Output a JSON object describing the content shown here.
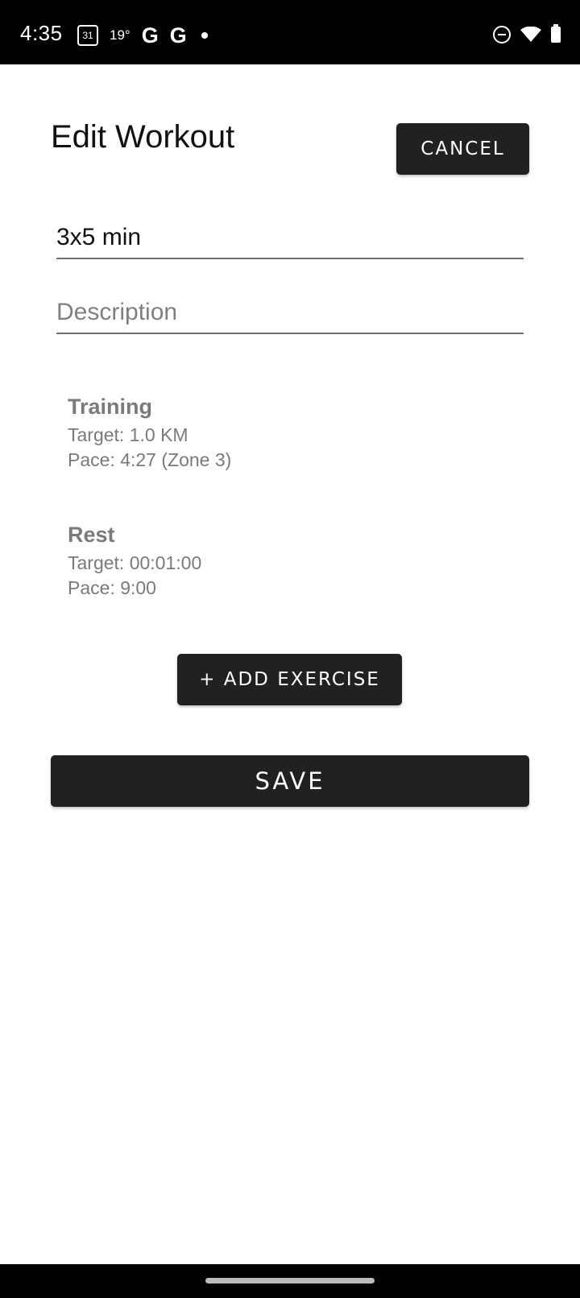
{
  "status_bar": {
    "time": "4:35",
    "calendar_day": "31",
    "temperature": "19°",
    "icons": [
      "calendar-icon",
      "google-icon",
      "google-icon",
      "notification-dot-icon",
      "do-not-disturb-icon",
      "wifi-icon",
      "battery-icon"
    ]
  },
  "header": {
    "title": "Edit Workout",
    "cancel_label": "CANCEL"
  },
  "form": {
    "name_value": "3x5 min",
    "description_placeholder": "Description"
  },
  "exercises": [
    {
      "title": "Training",
      "target": "Target: 1.0 KM",
      "pace": "Pace: 4:27 (Zone 3)"
    },
    {
      "title": "Rest",
      "target": "Target: 00:01:00",
      "pace": "Pace: 9:00"
    }
  ],
  "actions": {
    "add_exercise_label": "+ ADD EXERCISE",
    "save_label": "SAVE"
  },
  "colors": {
    "button_bg": "#212121",
    "status_bar_bg": "#000000",
    "muted_text": "#7a7a7a"
  }
}
